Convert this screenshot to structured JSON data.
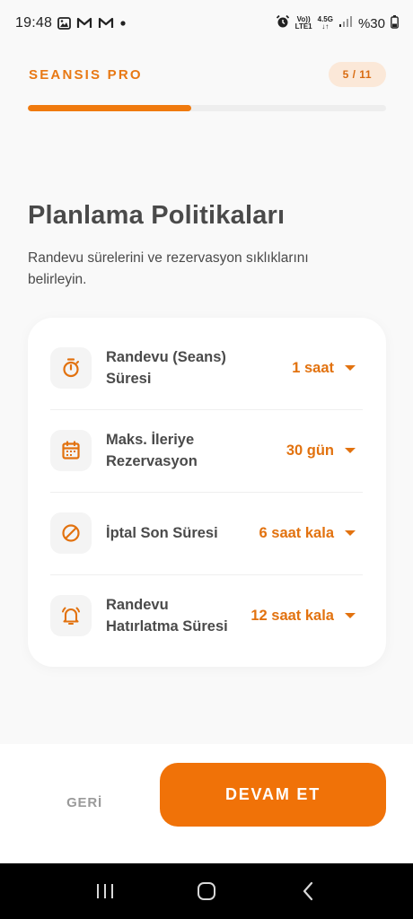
{
  "status_bar": {
    "time": "19:48",
    "network_top": "Vo))",
    "network_bottom": "LTE1",
    "net_gen": "4.5G",
    "battery": "%30"
  },
  "header": {
    "brand": "SEANSIS PRO",
    "step": "5 / 11",
    "progress": 0.455
  },
  "page": {
    "title": "Planlama Politikaları",
    "description": "Randevu sürelerini ve rezervasyon sıklıklarını belirleyin."
  },
  "settings": [
    {
      "label": "Randevu (Seans) Süresi",
      "value": "1 saat",
      "icon": "stopwatch-icon"
    },
    {
      "label": "Maks. İleriye Rezervasyon",
      "value": "30 gün",
      "icon": "calendar-icon"
    },
    {
      "label": "İptal Son Süresi",
      "value": "6 saat kala",
      "icon": "cancel-icon"
    },
    {
      "label": "Randevu Hatırlatma Süresi",
      "value": "12 saat kala",
      "icon": "bell-icon"
    }
  ],
  "actions": {
    "back_label": "GERİ",
    "continue_label": "DEVAM ET"
  },
  "colors": {
    "accent": "#f07208",
    "accent_text": "#e2720f",
    "badge_bg": "#fbe8d8"
  }
}
